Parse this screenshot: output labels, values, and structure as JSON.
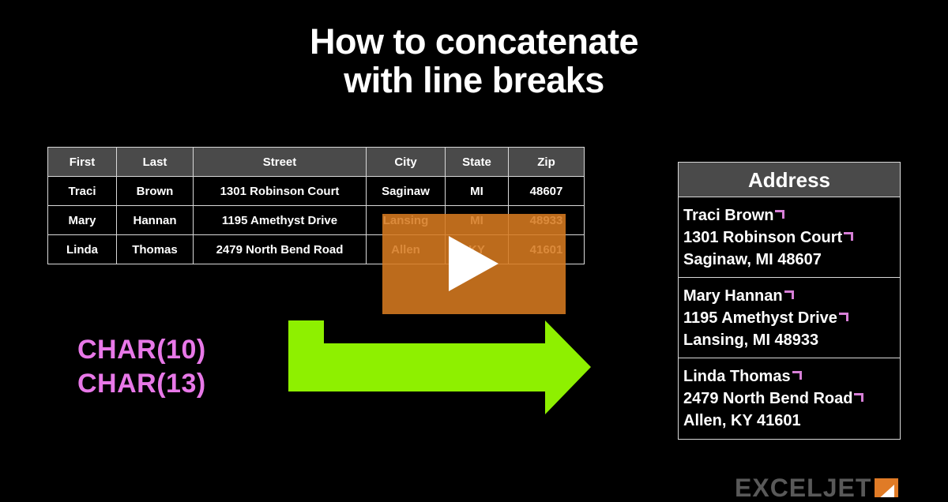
{
  "title": {
    "line1": "How to concatenate",
    "line2": "with line breaks"
  },
  "source_table": {
    "name": "source-data-table",
    "headers": [
      "First",
      "Last",
      "Street",
      "City",
      "State",
      "Zip"
    ],
    "rows": [
      [
        "Traci",
        "Brown",
        "1301 Robinson Court",
        "Saginaw",
        "MI",
        "48607"
      ],
      [
        "Mary",
        "Hannan",
        "1195 Amethyst Drive",
        "Lansing",
        "MI",
        "48933"
      ],
      [
        "Linda",
        "Thomas",
        "2479 North Bend Road",
        "Allen",
        "KY",
        "41601"
      ]
    ]
  },
  "formulas": {
    "char10": "CHAR(10)",
    "char13": "CHAR(13)",
    "color": "#e878e8"
  },
  "arrow": {
    "icon": "bent-right-arrow-icon",
    "color": "#8ef000"
  },
  "video_overlay": {
    "icon": "play-triangle-icon",
    "overlay_color": "#d67a20",
    "triangle_color": "#ffffff"
  },
  "address_panel": {
    "header": "Address",
    "entries": [
      {
        "line1": "Traci Brown",
        "line2": "1301 Robinson Court",
        "line3": "Saginaw, MI 48607"
      },
      {
        "line1": "Mary Hannan",
        "line2": "1195 Amethyst Drive",
        "line3": "Lansing, MI 48933"
      },
      {
        "line1": "Linda Thomas",
        "line2": "2479 North Bend Road",
        "line3": "Allen, KY 41601"
      }
    ],
    "line_break_marker_color": "#d77fd7"
  },
  "logo": {
    "text": "EXCELJET",
    "mark_color": "#e07b26",
    "text_color": "#595959"
  },
  "theme": {
    "background": "#000000",
    "header_fill": "#4a4a4a",
    "border": "#d9d9d9",
    "text": "#ffffff"
  }
}
